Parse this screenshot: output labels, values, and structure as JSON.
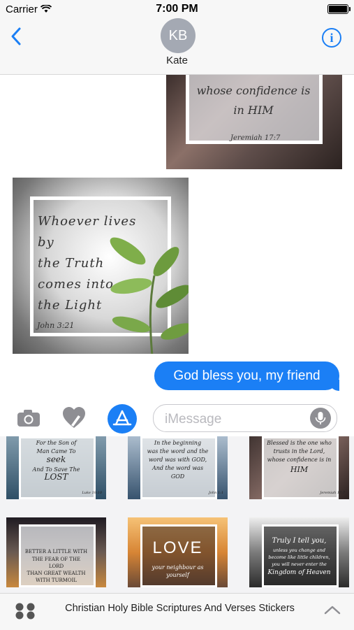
{
  "status": {
    "carrier": "Carrier",
    "time": "7:00 PM"
  },
  "conversation": {
    "avatar_initials": "KB",
    "contact_name": "Kate",
    "sticker1": {
      "text": "whose confidence is in HIM",
      "reference": "Jeremiah 17:7"
    },
    "sticker2": {
      "text_lines": [
        "Whoever lives by",
        "the Truth",
        "comes into",
        "the Light"
      ],
      "reference": "John 3:21"
    },
    "outgoing_message": "God bless you, my friend"
  },
  "input": {
    "placeholder": "iMessage"
  },
  "drawer": {
    "tiles": [
      {
        "lines": [
          "For the Son of",
          "Man Came To",
          "seek",
          "And To Save The",
          "LOST"
        ],
        "reference": "Luke 19:10"
      },
      {
        "lines": [
          "In the beginning",
          "was the word and the",
          "word was with GOD,",
          "And the word was",
          "GOD"
        ],
        "reference": "John 1:1"
      },
      {
        "lines": [
          "Blessed is the one who",
          "trusts in the Lord,",
          "whose confidence is in",
          "HIM"
        ],
        "reference": "Jeremiah 17:7"
      },
      {
        "lines": [
          "BETTER A LITTLE WITH",
          "THE FEAR OF THE",
          "LORD",
          "THAN GREAT WEALTH",
          "WITH TURMOIL"
        ],
        "reference": ""
      },
      {
        "lines": [
          "LOVE",
          "your neighbour as",
          "yourself"
        ],
        "reference": ""
      },
      {
        "lines": [
          "Truly I tell you,",
          "unless you change and",
          "become like little children,",
          "you will never enter the",
          "Kingdom of Heaven"
        ],
        "reference": ""
      }
    ]
  },
  "bottom_bar": {
    "title": "Christian Holy Bible Scriptures And Verses Stickers"
  },
  "colors": {
    "accent": "#1b7ff5",
    "bubble": "#1b7ff5",
    "avatar": "#a4a9b3"
  },
  "icons": [
    "back-chevron-icon",
    "info-icon",
    "camera-icon",
    "digital-touch-heart-icon",
    "app-store-icon",
    "microphone-icon",
    "app-grid-icon",
    "chevron-up-icon"
  ]
}
